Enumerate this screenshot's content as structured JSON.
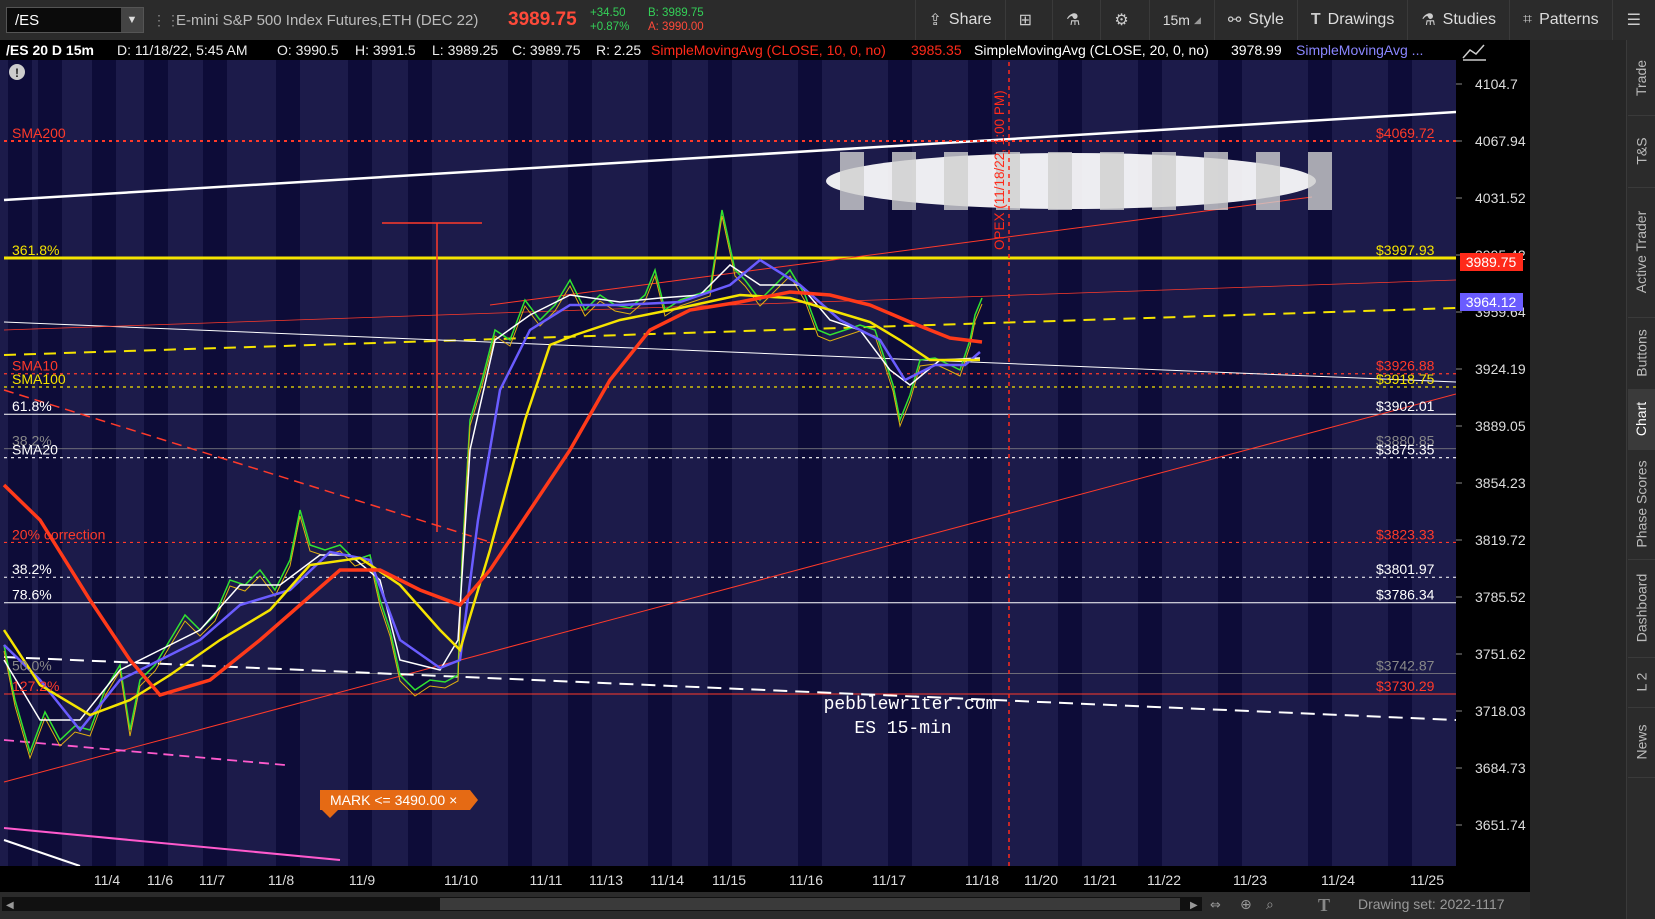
{
  "toolbar": {
    "symbol": "/ES",
    "description": "E-mini S&P 500 Index Futures,ETH (DEC 22)",
    "last_price": "3989.75",
    "change": "+34.50",
    "change_pct": "+0.87%",
    "bid": "B: 3989.75",
    "ask": "A: 3990.00",
    "buttons": {
      "share": "Share",
      "timeframe": "15m",
      "style": "Style",
      "drawings": "Drawings",
      "studies": "Studies",
      "patterns": "Patterns"
    }
  },
  "chart_header": {
    "title": "/ES 20 D 15m",
    "date": "D: 11/18/22, 5:45 AM",
    "open": "O: 3990.5",
    "high": "H: 3991.5",
    "low": "L: 3989.25",
    "close": "C: 3989.75",
    "range": "R: 2.25",
    "sma10_label": "SimpleMovingAvg (CLOSE, 10, 0, no)",
    "sma10_value": "3985.35",
    "sma20_label": "SimpleMovingAvg (CLOSE, 20, 0, no)",
    "sma20_value": "3978.99",
    "sma3_label": "SimpleMovingAvg ..."
  },
  "price_axis": {
    "ticks": [
      "4104.7",
      "4067.94",
      "4031.52",
      "3995.42",
      "3959.64",
      "3924.19",
      "3889.05",
      "3854.23",
      "3819.72",
      "3785.52",
      "3751.62",
      "3718.03",
      "3684.73",
      "3651.74"
    ],
    "last_price_tag": "3989.75",
    "sma_tag": "3964.12"
  },
  "time_axis": {
    "labels": [
      "11/4",
      "11/6",
      "11/7",
      "11/8",
      "11/9",
      "11/10",
      "11/11",
      "11/13",
      "11/14",
      "11/15",
      "11/16",
      "11/17",
      "11/18",
      "11/20",
      "11/21",
      "11/22",
      "11/23",
      "11/24",
      "11/25"
    ]
  },
  "levels": [
    {
      "left": "SMA200",
      "right": "$4069.72",
      "color": "#ff3a2a"
    },
    {
      "left": "361.8%",
      "right": "$3997.93",
      "color": "#f5e400"
    },
    {
      "left": "SMA10",
      "right": "$3926.88",
      "color": "#ff3a2a"
    },
    {
      "left": "SMA100",
      "right": "$3918.75",
      "color": "#f5e400"
    },
    {
      "left": "61.8%",
      "right": "$3902.01",
      "color": "#ffffff"
    },
    {
      "left": "38.2%",
      "right": "$3880.85",
      "color": "#888888"
    },
    {
      "left": "SMA20",
      "right": "$3875.35",
      "color": "#ffffff"
    },
    {
      "left": "20% correction",
      "right": "$3823.33",
      "color": "#ff3a2a"
    },
    {
      "left": "38.2%",
      "right": "$3801.97",
      "color": "#ffffff"
    },
    {
      "left": "78.6%",
      "right": "$3786.34",
      "color": "#ffffff"
    },
    {
      "left": "50.0%",
      "right": "$3742.87",
      "color": "#888888"
    },
    {
      "left": "127.2%",
      "right": "$3730.29",
      "color": "#ff3a2a"
    }
  ],
  "annotations": {
    "opex": "OPEX (11/18/22, 1:00 PM)",
    "watermark_site": "pebblewriter.com",
    "watermark_sub": "ES 15-min",
    "mark_order": "MARK <= 3490.00 ×",
    "warning_icon": "!"
  },
  "footer": {
    "drawing_set": "Drawing set: 2022-1117"
  },
  "sidebar_tabs": [
    "Trade",
    "T&S",
    "Active Trader",
    "Buttons",
    "Chart",
    "Phase Scores",
    "Dashboard",
    "L 2",
    "News"
  ],
  "icons": [
    "share-icon",
    "flexgrid-icon",
    "flask-icon",
    "gear-icon",
    "style-icon",
    "drawings-icon",
    "studies-icon",
    "patterns-icon",
    "menu-icon"
  ]
}
